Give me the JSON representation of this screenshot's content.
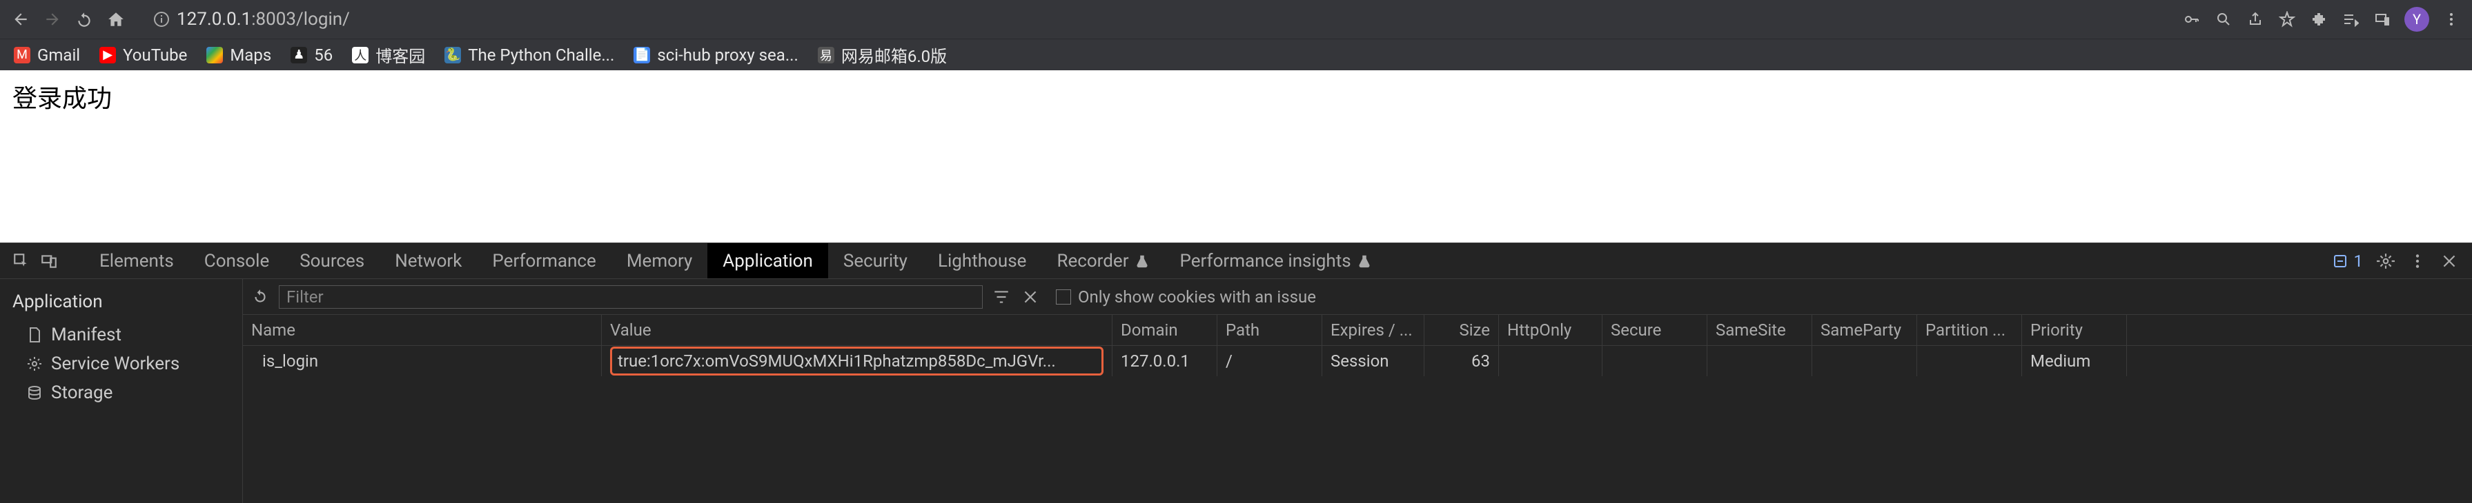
{
  "browser": {
    "url_prefix": "127.0.0.1",
    "url_rest": ":8003/login/",
    "avatar_letter": "Y"
  },
  "bookmarks": [
    {
      "label": "Gmail",
      "icon": "gmail"
    },
    {
      "label": "YouTube",
      "icon": "youtube"
    },
    {
      "label": "Maps",
      "icon": "maps"
    },
    {
      "label": "56",
      "icon": "56"
    },
    {
      "label": "博客园",
      "icon": "bokeyuan"
    },
    {
      "label": "The Python Challe...",
      "icon": "python"
    },
    {
      "label": "sci-hub proxy sea...",
      "icon": "scihub"
    },
    {
      "label": "网易邮箱6.0版",
      "icon": "netease"
    }
  ],
  "page": {
    "text": "登录成功"
  },
  "devtools": {
    "tabs": [
      "Elements",
      "Console",
      "Sources",
      "Network",
      "Performance",
      "Memory",
      "Application",
      "Security",
      "Lighthouse",
      "Recorder",
      "Performance insights"
    ],
    "active_tab": "Application",
    "issues_count": "1",
    "filter_placeholder": "Filter",
    "only_issues_label": "Only show cookies with an issue",
    "sidebar": {
      "heading": "Application",
      "items": [
        "Manifest",
        "Service Workers",
        "Storage"
      ]
    },
    "table": {
      "headers": [
        "Name",
        "Value",
        "Domain",
        "Path",
        "Expires / ...",
        "Size",
        "HttpOnly",
        "Secure",
        "SameSite",
        "SameParty",
        "Partition ...",
        "Priority"
      ],
      "row": {
        "name": "is_login",
        "value": "true:1orc7x:omVoS9MUQxMXHi1Rphatzmp858Dc_mJGVr...",
        "domain": "127.0.0.1",
        "path": "/",
        "expires": "Session",
        "size": "63",
        "httponly": "",
        "secure": "",
        "samesite": "",
        "sameparty": "",
        "partition": "",
        "priority": "Medium"
      }
    }
  }
}
